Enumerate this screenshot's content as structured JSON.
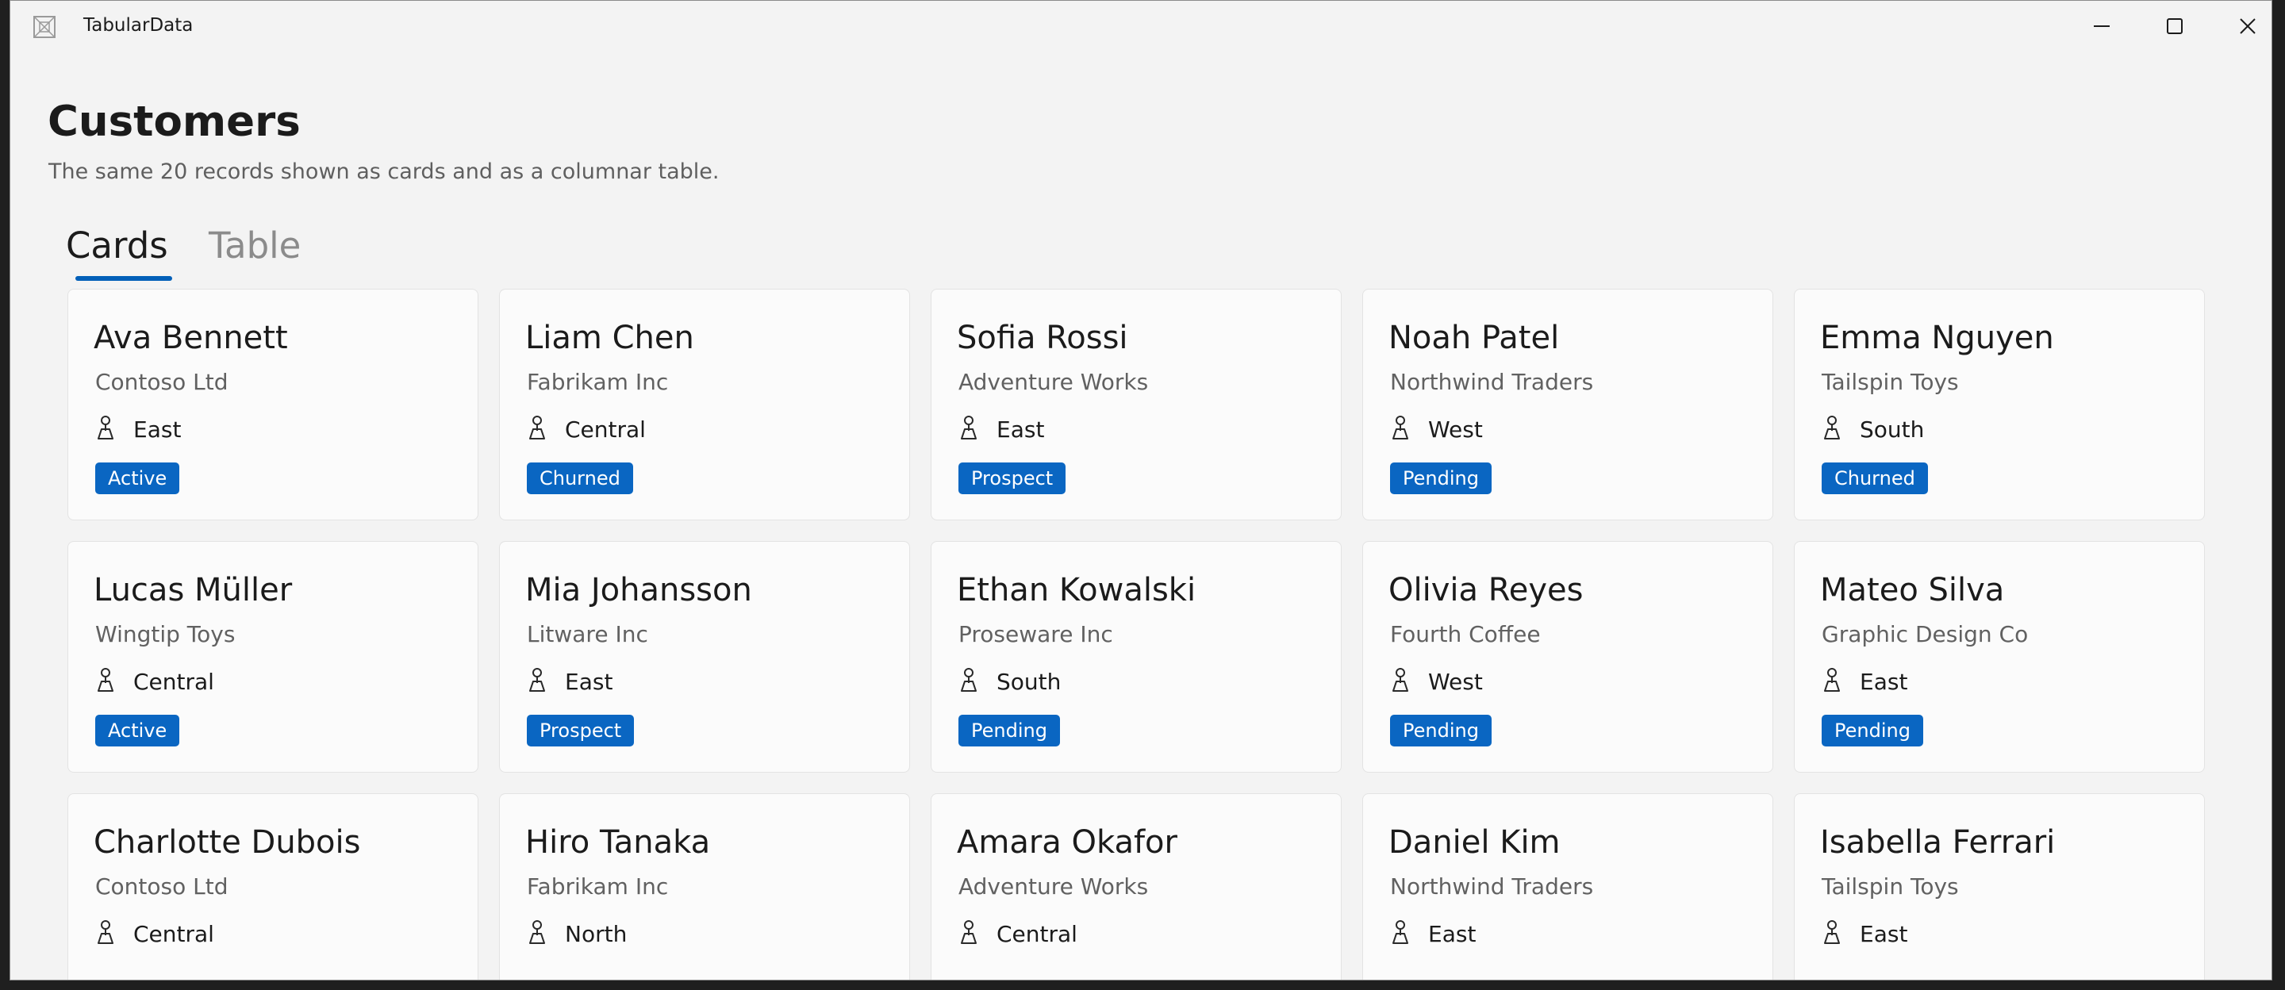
{
  "window": {
    "title": "TabularData",
    "icons": {
      "app": "app-icon",
      "minimize": "minimize-icon",
      "maximize": "maximize-icon",
      "close": "close-icon"
    }
  },
  "page": {
    "title": "Customers",
    "subtitle": "The same 20 records shown as cards and as a columnar table."
  },
  "tabs": [
    {
      "label": "Cards",
      "selected": true
    },
    {
      "label": "Table",
      "selected": false
    }
  ],
  "colors": {
    "accent": "#005fb8",
    "badge": "#0a66c2",
    "badge_text": "#ffffff",
    "background": "#f3f3f3",
    "card": "#fbfbfb"
  },
  "card_region_icon": "person-pin-icon",
  "cards": [
    {
      "name": "Ava Bennett",
      "company": "Contoso Ltd",
      "region": "East",
      "status": "Active"
    },
    {
      "name": "Liam Chen",
      "company": "Fabrikam Inc",
      "region": "Central",
      "status": "Churned"
    },
    {
      "name": "Sofia Rossi",
      "company": "Adventure Works",
      "region": "East",
      "status": "Prospect"
    },
    {
      "name": "Noah Patel",
      "company": "Northwind Traders",
      "region": "West",
      "status": "Pending"
    },
    {
      "name": "Emma Nguyen",
      "company": "Tailspin Toys",
      "region": "South",
      "status": "Churned"
    },
    {
      "name": "Lucas Müller",
      "company": "Wingtip Toys",
      "region": "Central",
      "status": "Active"
    },
    {
      "name": "Mia Johansson",
      "company": "Litware Inc",
      "region": "East",
      "status": "Prospect"
    },
    {
      "name": "Ethan Kowalski",
      "company": "Proseware Inc",
      "region": "South",
      "status": "Pending"
    },
    {
      "name": "Olivia Reyes",
      "company": "Fourth Coffee",
      "region": "West",
      "status": "Pending"
    },
    {
      "name": "Mateo Silva",
      "company": "Graphic Design Co",
      "region": "East",
      "status": "Pending"
    },
    {
      "name": "Charlotte Dubois",
      "company": "Contoso Ltd",
      "region": "Central",
      "status": ""
    },
    {
      "name": "Hiro Tanaka",
      "company": "Fabrikam Inc",
      "region": "North",
      "status": ""
    },
    {
      "name": "Amara Okafor",
      "company": "Adventure Works",
      "region": "Central",
      "status": ""
    },
    {
      "name": "Daniel Kim",
      "company": "Northwind Traders",
      "region": "East",
      "status": ""
    },
    {
      "name": "Isabella Ferrari",
      "company": "Tailspin Toys",
      "region": "East",
      "status": ""
    }
  ]
}
